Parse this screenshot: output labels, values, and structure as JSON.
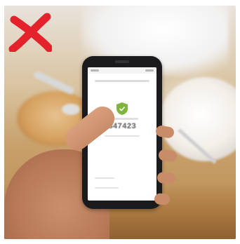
{
  "phone_screen": {
    "verification_code": "847423"
  },
  "overlay": {
    "mark_icon": "red-x-icon",
    "mark_color": "#e3222b"
  },
  "colors": {
    "shield_green": "#7fb53d",
    "phone_body": "#1b1b1d"
  }
}
